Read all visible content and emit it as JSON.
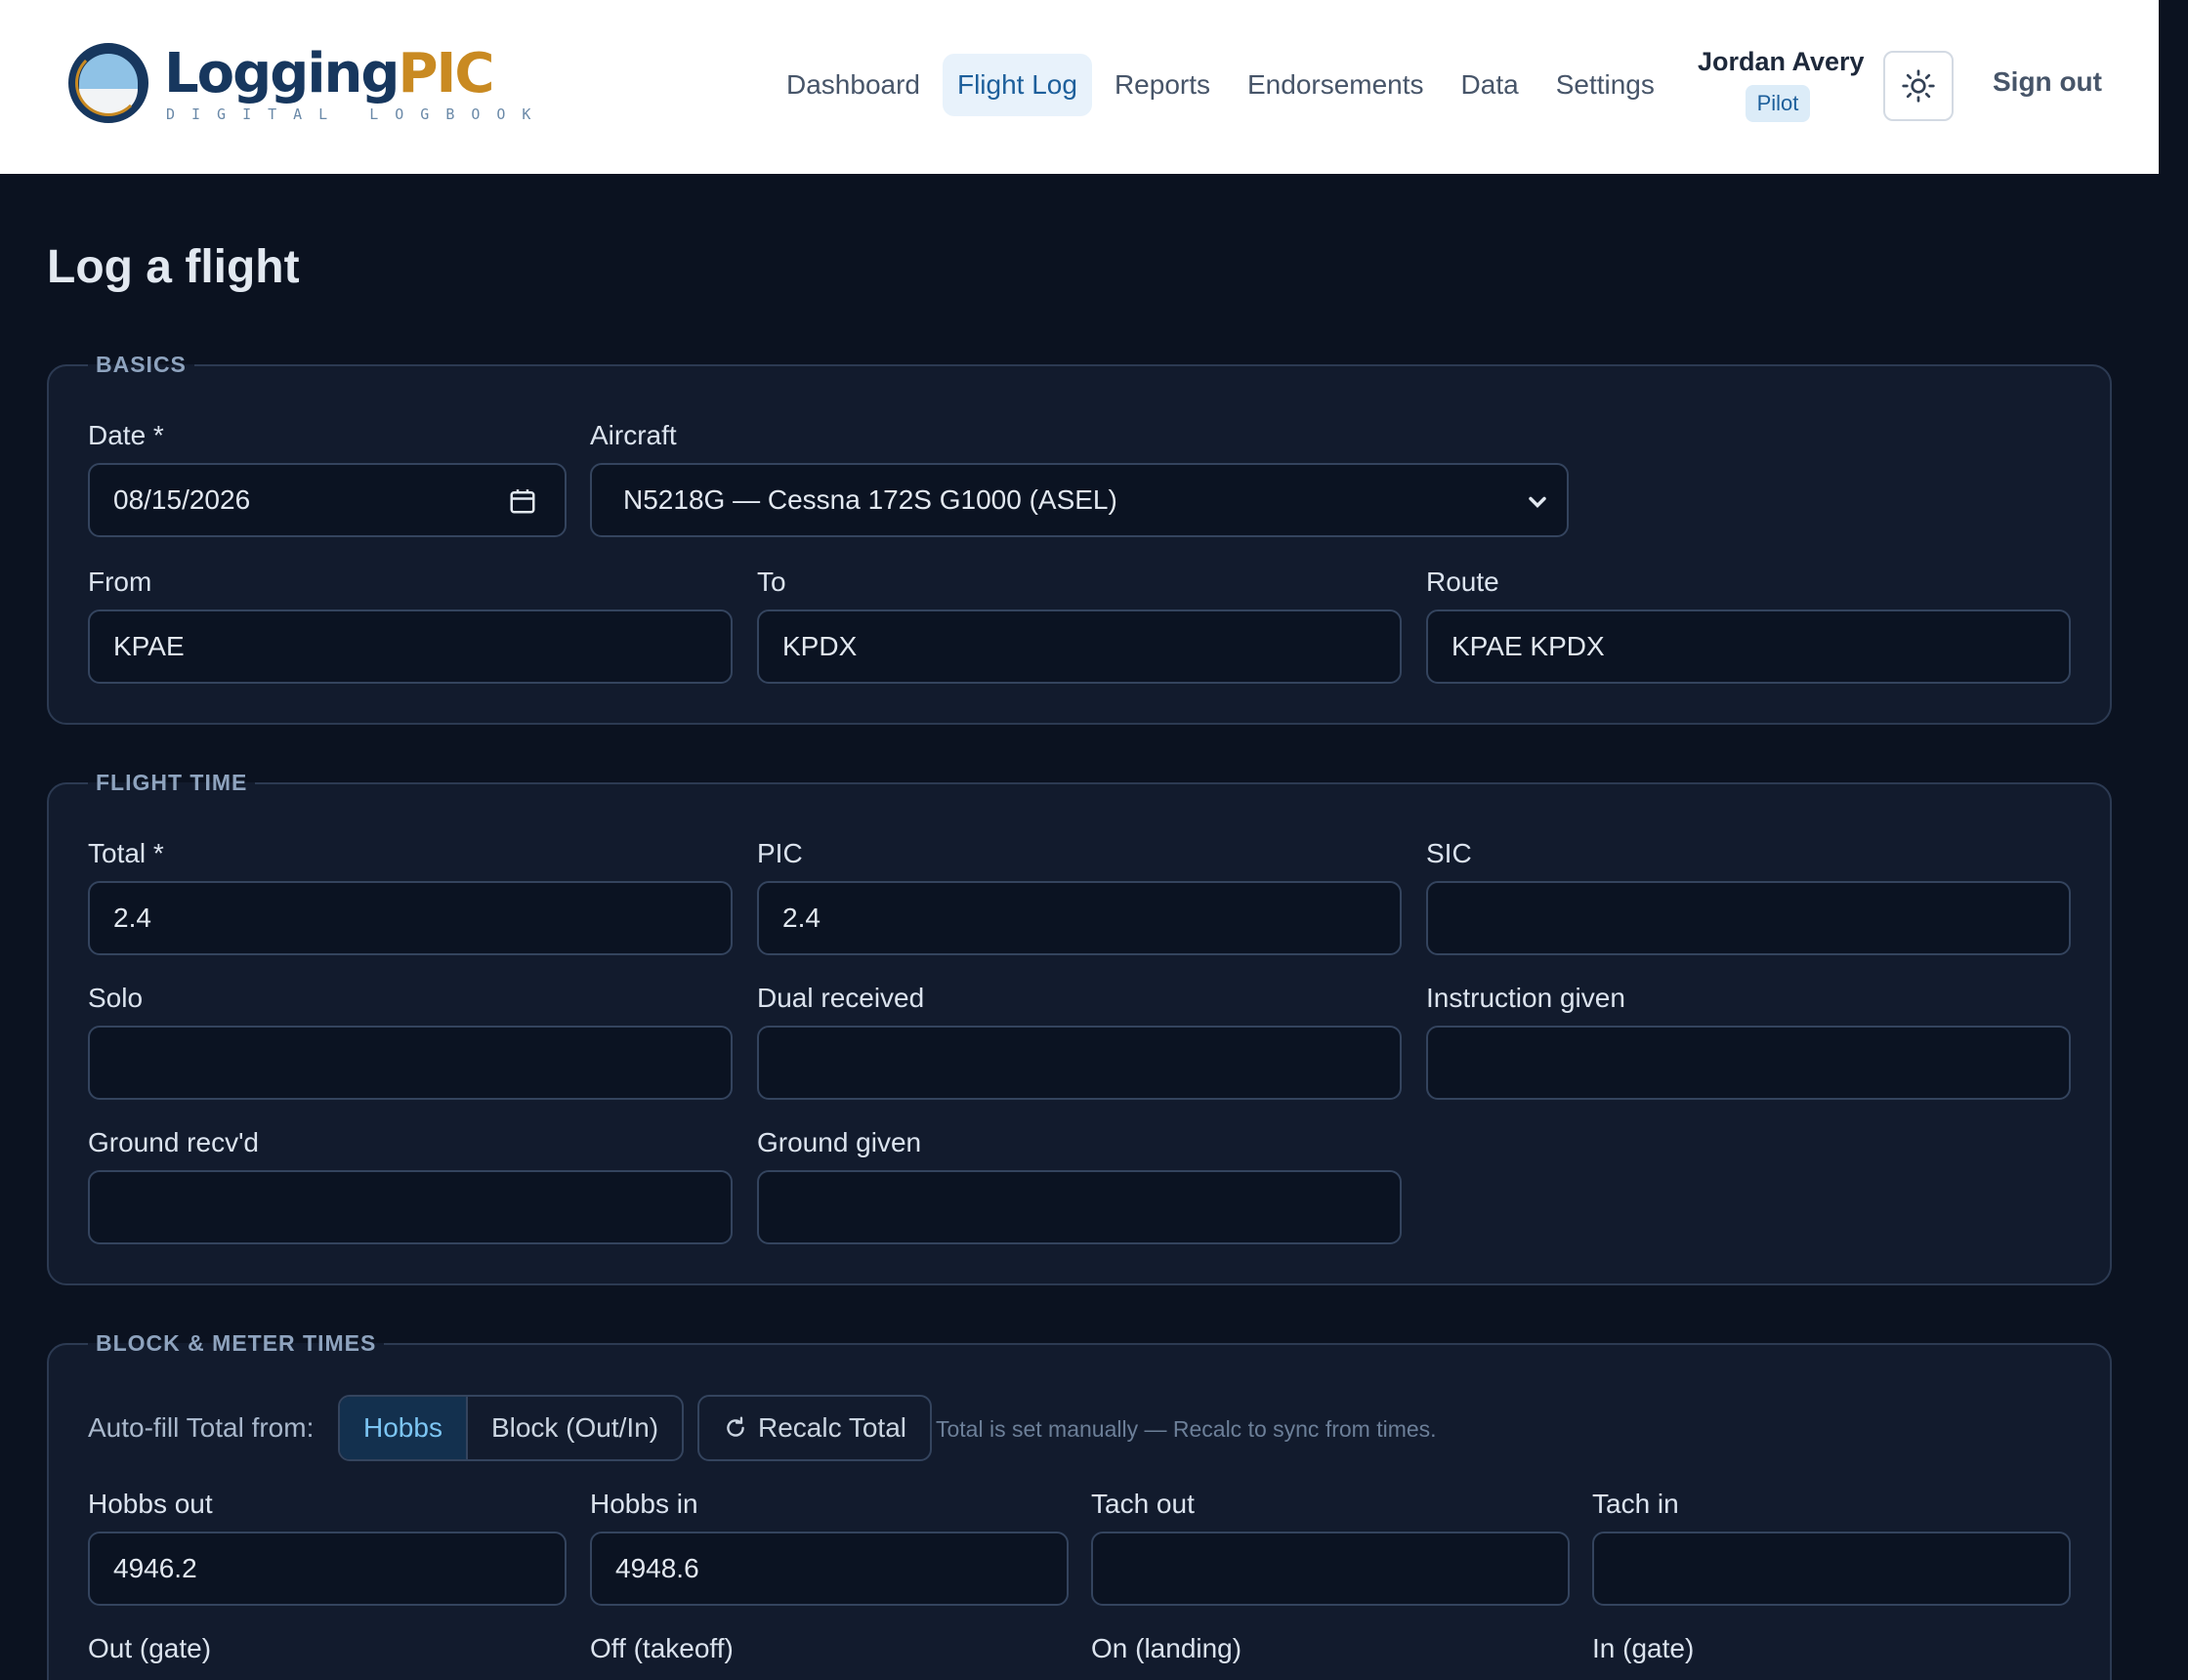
{
  "header": {
    "brand_main": "Logging",
    "brand_accent": "PIC",
    "brand_sub": "DIGITAL LOGBOOK",
    "nav": [
      "Dashboard",
      "Flight Log",
      "Reports",
      "Endorsements",
      "Data",
      "Settings"
    ],
    "active_nav": "Flight Log",
    "user_name": "Jordan Avery",
    "user_role": "Pilot",
    "theme_icon": "sun-icon",
    "signout_label": "Sign out"
  },
  "page": {
    "title": "Log a flight"
  },
  "basics": {
    "legend": "BASICS",
    "date_label": "Date *",
    "date_value": "08/15/2026",
    "aircraft_label": "Aircraft",
    "aircraft_value": "N5218G — Cessna 172S G1000 (ASEL)",
    "from_label": "From",
    "from_value": "KPAE",
    "to_label": "To",
    "to_value": "KPDX",
    "route_label": "Route",
    "route_value": "KPAE KPDX"
  },
  "flight_time": {
    "legend": "FLIGHT TIME",
    "total_label": "Total *",
    "total_value": "2.4",
    "pic_label": "PIC",
    "pic_value": "2.4",
    "sic_label": "SIC",
    "sic_value": "",
    "solo_label": "Solo",
    "solo_value": "",
    "dual_label": "Dual received",
    "dual_value": "",
    "instr_label": "Instruction given",
    "instr_value": "",
    "ground_recv_label": "Ground recv'd",
    "ground_recv_value": "",
    "ground_given_label": "Ground given",
    "ground_given_value": ""
  },
  "block": {
    "legend": "BLOCK & METER TIMES",
    "autofill_label": "Auto-fill Total from:",
    "seg_options": [
      "Hobbs",
      "Block (Out/In)"
    ],
    "seg_selected": "Hobbs",
    "recalc_label": "Recalc Total",
    "hint": "Total is set manually — Recalc to sync from times.",
    "hobbs_out_label": "Hobbs out",
    "hobbs_out_value": "4946.2",
    "hobbs_in_label": "Hobbs in",
    "hobbs_in_value": "4948.6",
    "tach_out_label": "Tach out",
    "tach_out_value": "",
    "tach_in_label": "Tach in",
    "tach_in_value": "",
    "out_label": "Out (gate)",
    "off_label": "Off (takeoff)",
    "on_label": "On (landing)",
    "in_label": "In (gate)"
  },
  "colors": {
    "brand_blue": "#17375e",
    "brand_gold": "#c98a22",
    "background": "#0b1220",
    "panel": "#121b2d",
    "accent": "#7cc5f3"
  }
}
